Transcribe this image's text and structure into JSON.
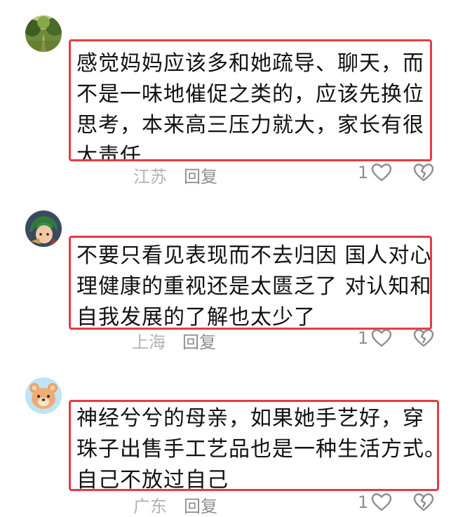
{
  "comments": [
    {
      "avatar": "forest-path-avatar",
      "lines": [
        "感觉妈妈应该多和她疏导、聊天，而",
        "不是一味地催促之类的，应该先换位",
        "思考，本来高三压力就大，家长有很",
        "大责任"
      ],
      "location": "江苏",
      "reply_label": "回复",
      "likes": "1"
    },
    {
      "avatar": "anime-character-avatar",
      "lines": [
        "不要只看见表现而不去归因 国人对心",
        "理健康的重视还是太匮乏了 对认知和",
        "自我发展的了解也太少了"
      ],
      "location": "上海",
      "reply_label": "回复",
      "likes": "1"
    },
    {
      "avatar": "cartoon-bear-avatar",
      "lines": [
        "神经兮兮的母亲，如果她手艺好，穿",
        "珠子出售手工艺品也是一种生活方式。",
        "自己不放过自己"
      ],
      "location": "广东",
      "reply_label": "回复",
      "likes": "1"
    }
  ],
  "colors": {
    "highlight_border": "#e53b46",
    "meta_text": "#8e8e8e",
    "location_text": "#b3b3b3"
  }
}
